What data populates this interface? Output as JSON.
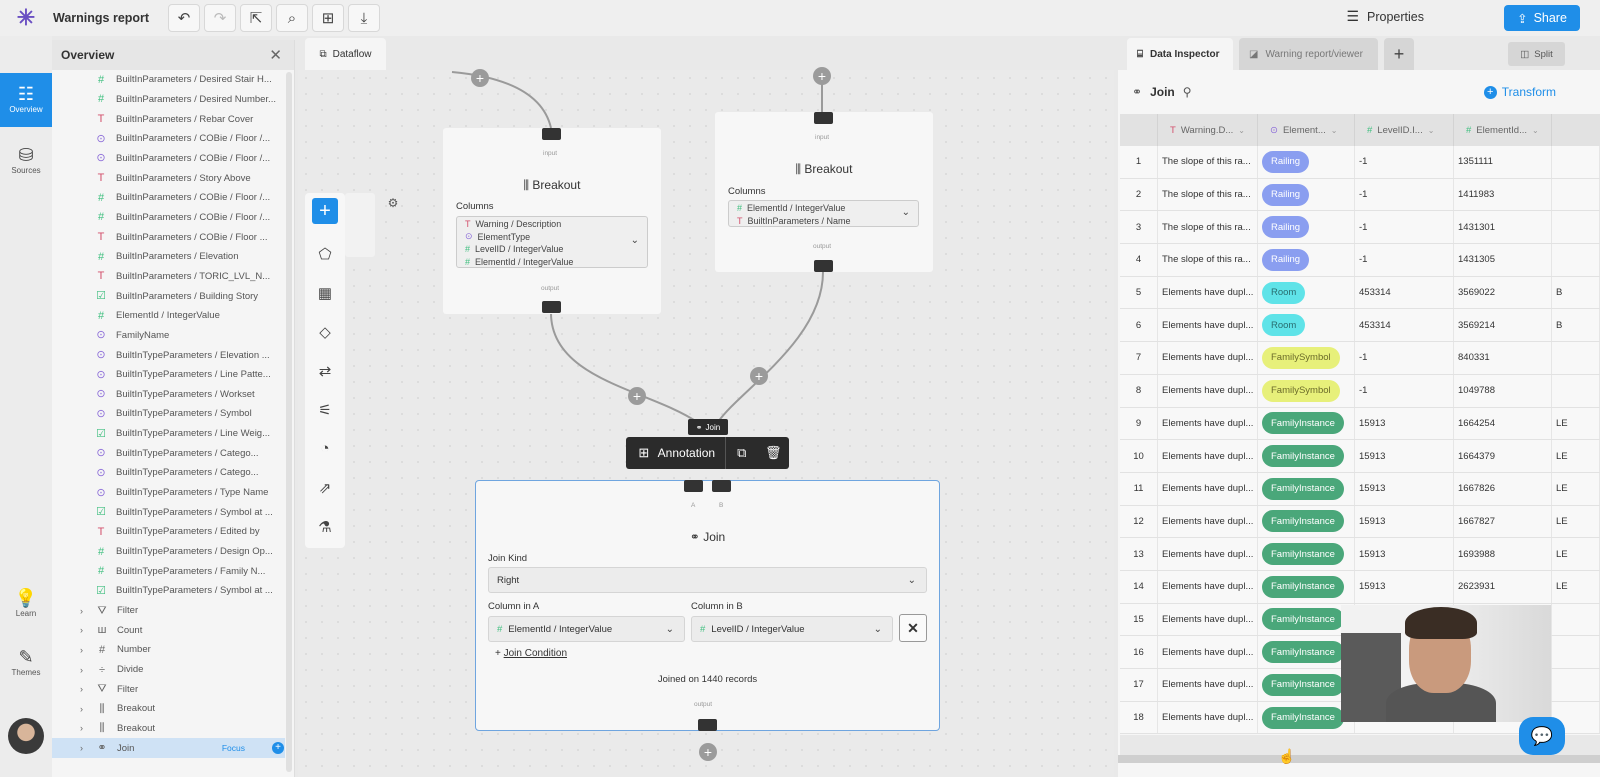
{
  "app": {
    "title": "Warnings report",
    "properties_label": "Properties",
    "share_label": "Share"
  },
  "rail": [
    {
      "label": "Overview",
      "icon": "overview-icon"
    },
    {
      "label": "Sources",
      "icon": "database-icon"
    },
    {
      "label": "Learn",
      "icon": "lightbulb-icon"
    },
    {
      "label": "Themes",
      "icon": "palette-icon"
    }
  ],
  "overview": {
    "title": "Overview",
    "items": [
      {
        "type": "hash",
        "label": "BuiltInParameters / Desired Stair H..."
      },
      {
        "type": "hash",
        "label": "BuiltInParameters / Desired Number..."
      },
      {
        "type": "t",
        "label": "BuiltInParameters / Rebar Cover"
      },
      {
        "type": "circ",
        "label": "BuiltInParameters / COBie / Floor /..."
      },
      {
        "type": "circ",
        "label": "BuiltInParameters / COBie / Floor /..."
      },
      {
        "type": "t",
        "label": "BuiltInParameters / Story Above"
      },
      {
        "type": "hash",
        "label": "BuiltInParameters / COBie / Floor /..."
      },
      {
        "type": "hash",
        "label": "BuiltInParameters / COBie / Floor /..."
      },
      {
        "type": "t",
        "label": "BuiltInParameters / COBie / Floor ..."
      },
      {
        "type": "hash",
        "label": "BuiltInParameters / Elevation"
      },
      {
        "type": "t",
        "label": "BuiltInParameters / TORIC_LVL_N..."
      },
      {
        "type": "chk",
        "label": "BuiltInParameters / Building Story"
      },
      {
        "type": "hash",
        "label": "ElementId / IntegerValue"
      },
      {
        "type": "circ",
        "label": "FamilyName"
      },
      {
        "type": "circ",
        "label": "BuiltInTypeParameters / Elevation ..."
      },
      {
        "type": "circ",
        "label": "BuiltInTypeParameters / Line Patte..."
      },
      {
        "type": "circ",
        "label": "BuiltInTypeParameters / Workset"
      },
      {
        "type": "circ",
        "label": "BuiltInTypeParameters / Symbol"
      },
      {
        "type": "chk",
        "label": "BuiltInTypeParameters / Line Weig..."
      },
      {
        "type": "circ",
        "label": "BuiltInTypeParameters / Catego..."
      },
      {
        "type": "circ",
        "label": "BuiltInTypeParameters / Catego..."
      },
      {
        "type": "circ",
        "label": "BuiltInTypeParameters / Type Name"
      },
      {
        "type": "chk",
        "label": "BuiltInTypeParameters / Symbol at ..."
      },
      {
        "type": "t",
        "label": "BuiltInTypeParameters / Edited by"
      },
      {
        "type": "hash",
        "label": "BuiltInTypeParameters / Design Op..."
      },
      {
        "type": "hash",
        "label": "BuiltInTypeParameters / Family N..."
      },
      {
        "type": "chk",
        "label": "BuiltInTypeParameters / Symbol at ..."
      }
    ],
    "groups": [
      {
        "icon": "filter-icon",
        "glyph": "⛛",
        "label": "Filter"
      },
      {
        "icon": "count-icon",
        "glyph": "ш",
        "label": "Count"
      },
      {
        "icon": "number-icon",
        "glyph": "#",
        "label": "Number"
      },
      {
        "icon": "divide-icon",
        "glyph": "÷",
        "label": "Divide"
      },
      {
        "icon": "filter-icon",
        "glyph": "⛛",
        "label": "Filter"
      },
      {
        "icon": "breakout-icon",
        "glyph": "⫼",
        "label": "Breakout"
      },
      {
        "icon": "breakout-icon",
        "glyph": "⫼",
        "label": "Breakout"
      }
    ],
    "selected": {
      "label": "Join",
      "focus_label": "Focus"
    }
  },
  "dataflow": {
    "tab_label": "Dataflow",
    "breakout1": {
      "title": "Breakout",
      "input_label": "input",
      "output_label": "output",
      "columns_label": "Columns",
      "columns": [
        {
          "type": "t",
          "label": "Warning / Description"
        },
        {
          "type": "circ",
          "label": "ElementType"
        },
        {
          "type": "hash",
          "label": "LevelID / IntegerValue"
        },
        {
          "type": "hash",
          "label": "ElementId / IntegerValue"
        }
      ]
    },
    "breakout2": {
      "title": "Breakout",
      "input_label": "input",
      "output_label": "output",
      "columns_label": "Columns",
      "columns": [
        {
          "type": "hash",
          "label": "ElementId / IntegerValue"
        },
        {
          "type": "t",
          "label": "BuiltInParameters / Name"
        }
      ]
    },
    "annotation": {
      "label": "Annotation",
      "join_tag": "Join"
    },
    "join": {
      "title": "Join",
      "port_a": "A",
      "port_b": "B",
      "output_label": "output",
      "join_kind_label": "Join Kind",
      "join_kind_value": "Right",
      "col_a_label": "Column in A",
      "col_a_value": "ElementId / IntegerValue",
      "col_b_label": "Column in B",
      "col_b_value": "LevelID / IntegerValue",
      "add_condition": "Join Condition",
      "status": "Joined on 1440 records"
    }
  },
  "inspector": {
    "tabs": [
      "Data Inspector",
      "Warning report/viewer"
    ],
    "split_label": "Split",
    "title": "Join",
    "transform_label": "Transform",
    "columns": [
      {
        "icon": "t",
        "label": "Warning.D..."
      },
      {
        "icon": "circ",
        "label": "Element..."
      },
      {
        "icon": "hash",
        "label": "LevelID.I..."
      },
      {
        "icon": "hash",
        "label": "ElementId..."
      }
    ],
    "rows": [
      {
        "n": "1",
        "warning": "The slope of this ra...",
        "type": "Railing",
        "level": "-1",
        "id": "1351111",
        "extra": ""
      },
      {
        "n": "2",
        "warning": "The slope of this ra...",
        "type": "Railing",
        "level": "-1",
        "id": "1411983",
        "extra": ""
      },
      {
        "n": "3",
        "warning": "The slope of this ra...",
        "type": "Railing",
        "level": "-1",
        "id": "1431301",
        "extra": ""
      },
      {
        "n": "4",
        "warning": "The slope of this ra...",
        "type": "Railing",
        "level": "-1",
        "id": "1431305",
        "extra": ""
      },
      {
        "n": "5",
        "warning": "Elements have dupl...",
        "type": "Room",
        "level": "453314",
        "id": "3569022",
        "extra": "B"
      },
      {
        "n": "6",
        "warning": "Elements have dupl...",
        "type": "Room",
        "level": "453314",
        "id": "3569214",
        "extra": "B"
      },
      {
        "n": "7",
        "warning": "Elements have dupl...",
        "type": "FamilySymbol",
        "level": "-1",
        "id": "840331",
        "extra": ""
      },
      {
        "n": "8",
        "warning": "Elements have dupl...",
        "type": "FamilySymbol",
        "level": "-1",
        "id": "1049788",
        "extra": ""
      },
      {
        "n": "9",
        "warning": "Elements have dupl...",
        "type": "FamilyInstance",
        "level": "15913",
        "id": "1664254",
        "extra": "LE"
      },
      {
        "n": "10",
        "warning": "Elements have dupl...",
        "type": "FamilyInstance",
        "level": "15913",
        "id": "1664379",
        "extra": "LE"
      },
      {
        "n": "11",
        "warning": "Elements have dupl...",
        "type": "FamilyInstance",
        "level": "15913",
        "id": "1667826",
        "extra": "LE"
      },
      {
        "n": "12",
        "warning": "Elements have dupl...",
        "type": "FamilyInstance",
        "level": "15913",
        "id": "1667827",
        "extra": "LE"
      },
      {
        "n": "13",
        "warning": "Elements have dupl...",
        "type": "FamilyInstance",
        "level": "15913",
        "id": "1693988",
        "extra": "LE"
      },
      {
        "n": "14",
        "warning": "Elements have dupl...",
        "type": "FamilyInstance",
        "level": "15913",
        "id": "2623931",
        "extra": "LE"
      },
      {
        "n": "15",
        "warning": "Elements have dupl...",
        "type": "FamilyInstance",
        "level": "",
        "id": "",
        "extra": ""
      },
      {
        "n": "16",
        "warning": "Elements have dupl...",
        "type": "FamilyInstance",
        "level": "",
        "id": "",
        "extra": ""
      },
      {
        "n": "17",
        "warning": "Elements have dupl...",
        "type": "FamilyInstance",
        "level": "",
        "id": "",
        "extra": ""
      },
      {
        "n": "18",
        "warning": "Elements have dupl...",
        "type": "FamilyInstance",
        "level": "",
        "id": "",
        "extra": ""
      }
    ],
    "chip_colors": {
      "Railing": "#8a9ef0",
      "Room": "#5fe3e8",
      "FamilySymbol": "#e7f07a",
      "FamilyInstance": "#4aa77a"
    },
    "chip_text_colors": {
      "Railing": "#ffffff",
      "Room": "#2a6e70",
      "FamilySymbol": "#6b6b2a",
      "FamilyInstance": "#ffffff"
    }
  },
  "colors": {
    "accent": "#1f8ee8",
    "brand": "#6a4fc2",
    "hash": "#3fbf7f",
    "text_type": "#d24f6b",
    "enum_type": "#8b6bd8"
  }
}
